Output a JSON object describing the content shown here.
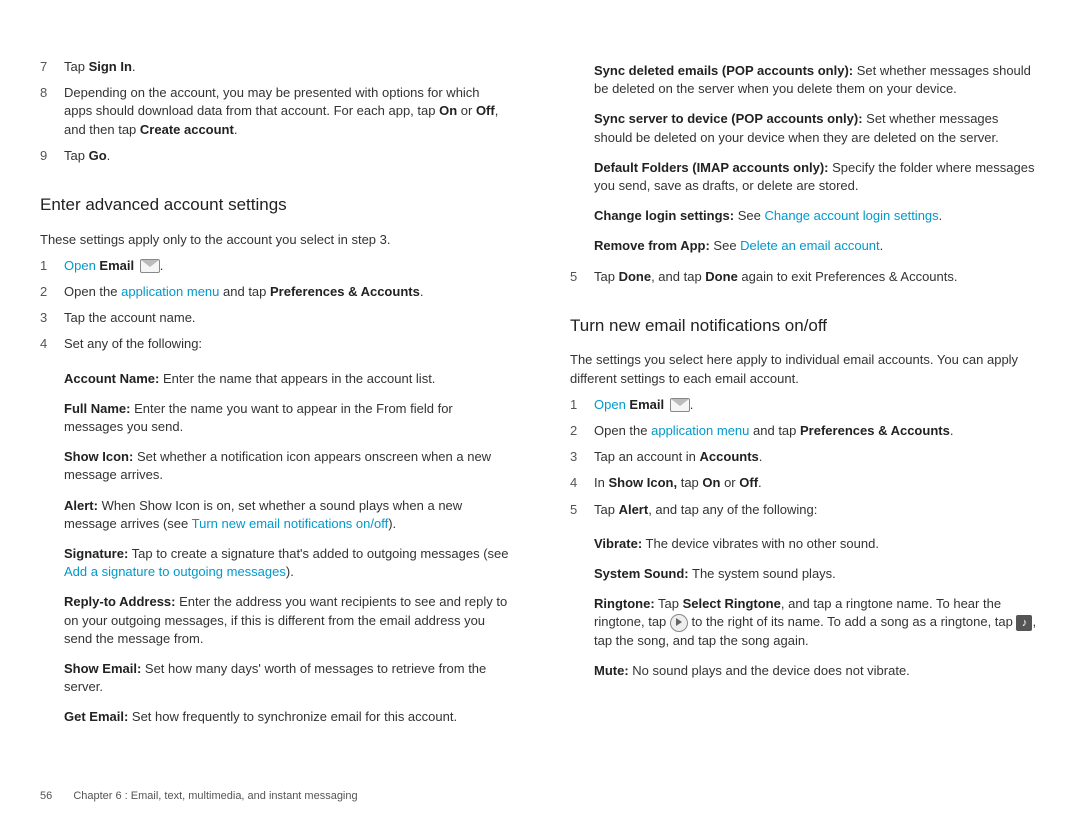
{
  "left": {
    "steps_top": [
      {
        "n": "7",
        "parts": [
          {
            "t": "Tap "
          },
          {
            "b": "Sign In"
          },
          {
            "t": "."
          }
        ]
      },
      {
        "n": "8",
        "parts": [
          {
            "t": "Depending on the account, you may be presented with options for which apps should download data from that account. For each app, tap "
          },
          {
            "b": "On"
          },
          {
            "t": " or "
          },
          {
            "b": "Off"
          },
          {
            "t": ", and then tap "
          },
          {
            "b": "Create account"
          },
          {
            "t": "."
          }
        ]
      },
      {
        "n": "9",
        "parts": [
          {
            "t": "Tap "
          },
          {
            "b": "Go"
          },
          {
            "t": "."
          }
        ]
      }
    ],
    "h_advanced": "Enter advanced account settings",
    "advanced_intro": "These settings apply only to the account you select in step 3.",
    "steps_adv": [
      {
        "n": "1",
        "parts": [
          {
            "link": "Open "
          },
          {
            "linkb": "Email"
          },
          {
            "t": " "
          },
          {
            "icon": "email"
          },
          {
            "t": "."
          }
        ]
      },
      {
        "n": "2",
        "parts": [
          {
            "t": "Open the "
          },
          {
            "link": "application menu"
          },
          {
            "t": " and tap "
          },
          {
            "b": "Preferences & Accounts"
          },
          {
            "t": "."
          }
        ]
      },
      {
        "n": "3",
        "parts": [
          {
            "t": "Tap the account name."
          }
        ]
      },
      {
        "n": "4",
        "parts": [
          {
            "t": "Set any of the following:"
          }
        ]
      }
    ],
    "settings": [
      [
        {
          "b": "Account Name:"
        },
        {
          "t": " Enter the name that appears in the account list."
        }
      ],
      [
        {
          "b": "Full Name:"
        },
        {
          "t": " Enter the name you want to appear in the From field for messages you send."
        }
      ],
      [
        {
          "b": "Show Icon:"
        },
        {
          "t": " Set whether a notification icon appears onscreen when a new message arrives."
        }
      ],
      [
        {
          "b": "Alert:"
        },
        {
          "t": " When Show Icon is on, set whether a sound plays when a new message arrives (see "
        },
        {
          "link": "Turn new email notifications on/off"
        },
        {
          "t": ")."
        }
      ],
      [
        {
          "b": "Signature:"
        },
        {
          "t": " Tap to create a signature that's added to outgoing messages (see "
        },
        {
          "link": "Add a signature to outgoing messages"
        },
        {
          "t": ")."
        }
      ],
      [
        {
          "b": "Reply-to Address:"
        },
        {
          "t": " Enter the address you want recipients to see and reply to on your outgoing messages, if this is different from the email address you send the message from."
        }
      ],
      [
        {
          "b": "Show Email:"
        },
        {
          "t": " Set how many days' worth of messages to retrieve from the server."
        }
      ],
      [
        {
          "b": "Get Email:"
        },
        {
          "t": " Set how frequently to synchronize email for this account."
        }
      ]
    ]
  },
  "right": {
    "settings_top": [
      [
        {
          "b": "Sync deleted emails (POP accounts only):"
        },
        {
          "t": " Set whether messages should be deleted on the server when you delete them on your device."
        }
      ],
      [
        {
          "b": "Sync server to device (POP accounts only):"
        },
        {
          "t": " Set whether messages should be deleted on your device when they are deleted on the server."
        }
      ],
      [
        {
          "b": "Default Folders (IMAP accounts only):"
        },
        {
          "t": " Specify the folder where messages you send, save as drafts, or delete are stored."
        }
      ],
      [
        {
          "b": "Change login settings:"
        },
        {
          "t": " See "
        },
        {
          "link": "Change account login settings"
        },
        {
          "t": "."
        }
      ],
      [
        {
          "b": "Remove from App:"
        },
        {
          "t": " See "
        },
        {
          "link": "Delete an email account"
        },
        {
          "t": "."
        }
      ]
    ],
    "step5": {
      "n": "5",
      "parts": [
        {
          "t": "Tap "
        },
        {
          "b": "Done"
        },
        {
          "t": ", and tap "
        },
        {
          "b": "Done"
        },
        {
          "t": " again to exit Preferences & Accounts."
        }
      ]
    },
    "h_notif": "Turn new email notifications on/off",
    "notif_intro": "The settings you select here apply to individual email accounts. You can apply different settings to each email account.",
    "steps_notif": [
      {
        "n": "1",
        "parts": [
          {
            "link": "Open "
          },
          {
            "linkb": "Email"
          },
          {
            "t": " "
          },
          {
            "icon": "email"
          },
          {
            "t": "."
          }
        ]
      },
      {
        "n": "2",
        "parts": [
          {
            "t": "Open the "
          },
          {
            "link": "application menu"
          },
          {
            "t": " and tap "
          },
          {
            "b": "Preferences & Accounts"
          },
          {
            "t": "."
          }
        ]
      },
      {
        "n": "3",
        "parts": [
          {
            "t": "Tap an account in "
          },
          {
            "b": "Accounts"
          },
          {
            "t": "."
          }
        ]
      },
      {
        "n": "4",
        "parts": [
          {
            "t": "In "
          },
          {
            "b": "Show Icon,"
          },
          {
            "t": " tap "
          },
          {
            "b": "On"
          },
          {
            "t": " or "
          },
          {
            "b": "Off"
          },
          {
            "t": "."
          }
        ]
      },
      {
        "n": "5",
        "parts": [
          {
            "t": "Tap "
          },
          {
            "b": "Alert"
          },
          {
            "t": ", and tap any of the following:"
          }
        ]
      }
    ],
    "alert_opts": [
      [
        {
          "b": "Vibrate:"
        },
        {
          "t": " The device vibrates with no other sound."
        }
      ],
      [
        {
          "b": "System Sound:"
        },
        {
          "t": " The system sound plays."
        }
      ],
      [
        {
          "b": "Ringtone:"
        },
        {
          "t": " Tap "
        },
        {
          "b": "Select Ringtone"
        },
        {
          "t": ", and tap a ringtone name. To hear the ringtone, tap "
        },
        {
          "icon": "play"
        },
        {
          "t": " to the right of its name. To add a song as a ringtone, tap "
        },
        {
          "icon": "music"
        },
        {
          "t": ", tap the song, and tap the song again."
        }
      ],
      [
        {
          "b": "Mute:"
        },
        {
          "t": " No sound plays and the device does not vibrate."
        }
      ]
    ]
  },
  "footer": {
    "page": "56",
    "text": "Chapter 6 : Email, text, multimedia, and instant messaging"
  }
}
